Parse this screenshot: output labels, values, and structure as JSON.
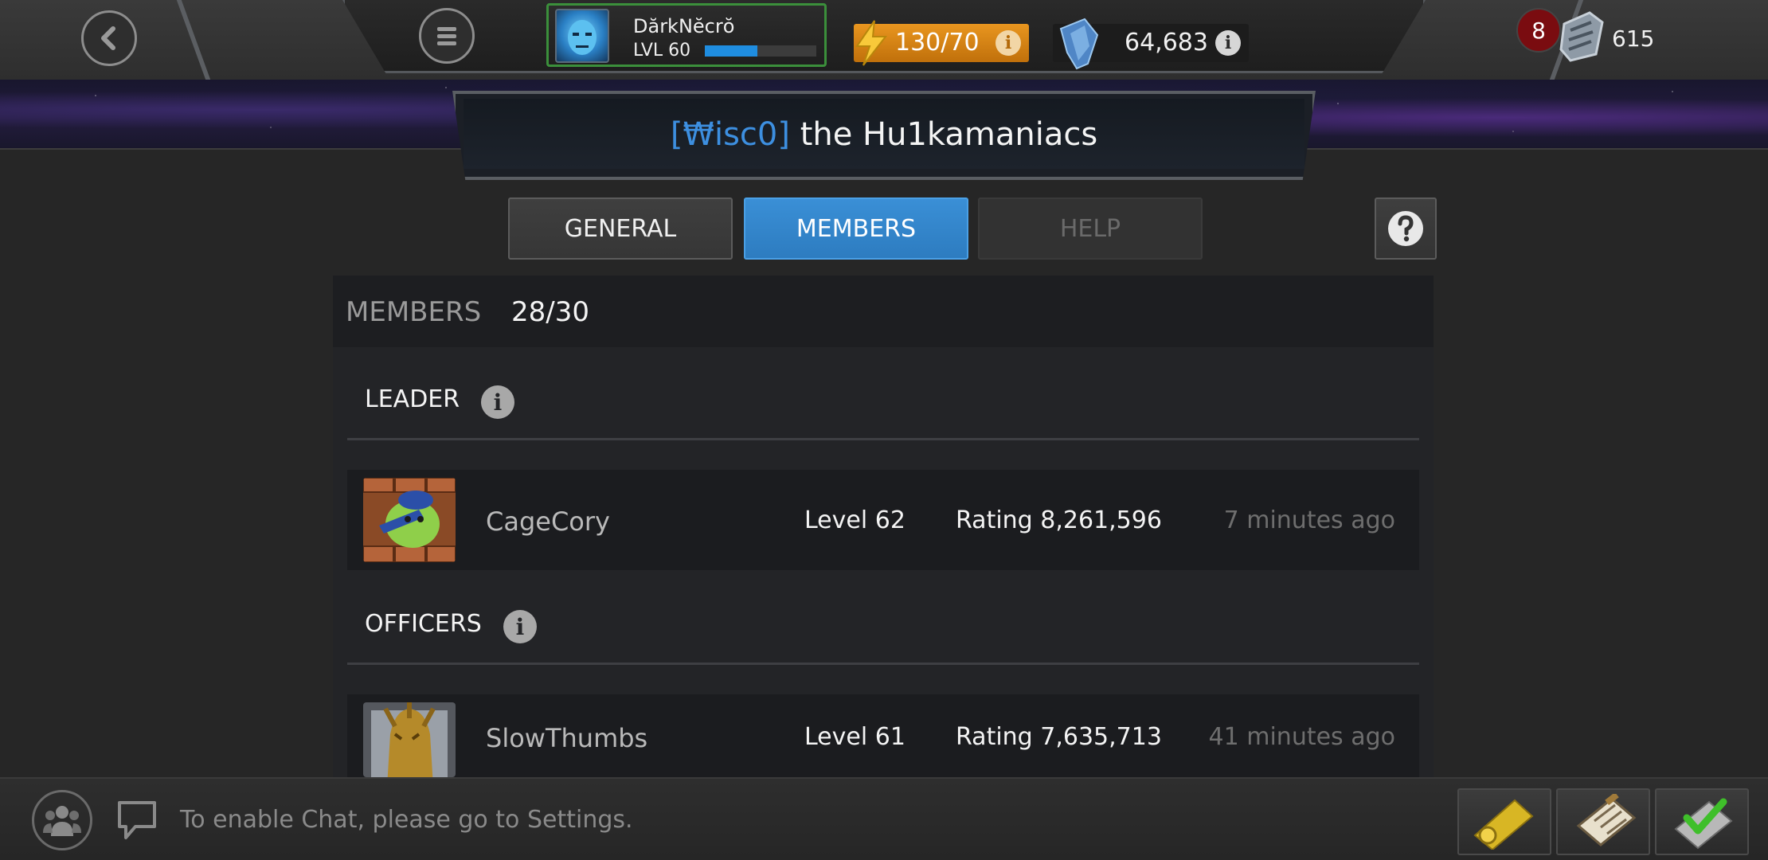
{
  "header": {
    "profile": {
      "name": "DărkNĕcrŏ",
      "level_label": "LVL 60",
      "xp_fraction": 0.47
    },
    "energy": {
      "value": "130/70"
    },
    "crystals": {
      "value": "64,683"
    },
    "notifications": {
      "count": "8"
    },
    "units": {
      "value": "615"
    }
  },
  "alliance": {
    "tag": "[₩isc0]",
    "name": "the Hu1kamaniacs"
  },
  "tabs": {
    "general": "GENERAL",
    "members": "MEMBERS",
    "help": "HELP"
  },
  "members_panel": {
    "label": "MEMBERS",
    "count": "28/30",
    "sections": [
      {
        "title": "LEADER",
        "members": [
          {
            "name": "CageCory",
            "level": "Level 62",
            "rating": "Rating 8,261,596",
            "last_seen": "7 minutes ago"
          }
        ]
      },
      {
        "title": "OFFICERS",
        "members": [
          {
            "name": "SlowThumbs",
            "level": "Level 61",
            "rating": "Rating 7,635,713",
            "last_seen": "41 minutes ago"
          }
        ]
      }
    ]
  },
  "chat": {
    "placeholder": "To enable Chat, please go to Settings."
  },
  "colors": {
    "accent": "#2d7cc0",
    "energy": "#e9961f",
    "tag": "#3d8fe0",
    "profile_border": "#3b8f3b"
  },
  "icons": [
    "back-icon",
    "menu-icon",
    "bolt-icon",
    "crystal-icon",
    "units-icon",
    "help-icon",
    "alliance-icon",
    "chat-icon",
    "trophy-icon",
    "quests-icon",
    "check-icon"
  ]
}
